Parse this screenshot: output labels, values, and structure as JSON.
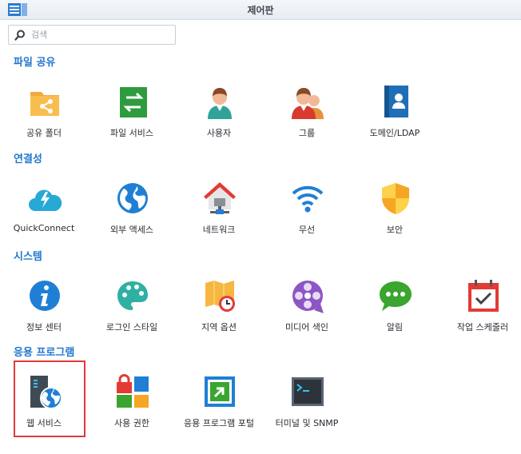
{
  "window": {
    "title": "제어판"
  },
  "search": {
    "placeholder": "검색"
  },
  "sections": [
    {
      "title": "파일 공유",
      "items": [
        "공유 폴더",
        "파일 서비스",
        "사용자",
        "그룹",
        "도메인/LDAP"
      ]
    },
    {
      "title": "연결성",
      "items": [
        "QuickConnect",
        "외부 액세스",
        "네트워크",
        "무선",
        "보안"
      ]
    },
    {
      "title": "시스템",
      "items": [
        "정보 센터",
        "로그인 스타일",
        "지역 옵션",
        "미디어 색인",
        "알림",
        "작업 스케줄러"
      ]
    },
    {
      "title": "응용 프로그램",
      "items": [
        "웹 서비스",
        "사용 권한",
        "응용 프로그램 포털",
        "터미널 및 SNMP"
      ]
    }
  ],
  "icons": [
    "shared-folder-icon",
    "file-services-icon",
    "user-icon",
    "group-icon",
    "domain-ldap-icon",
    "quickconnect-icon",
    "external-access-icon",
    "network-icon",
    "wireless-icon",
    "security-icon",
    "info-center-icon",
    "login-style-icon",
    "regional-options-icon",
    "media-index-icon",
    "notification-icon",
    "task-scheduler-icon",
    "web-services-icon",
    "privileges-icon",
    "application-portal-icon",
    "terminal-snmp-icon"
  ],
  "colors": {
    "section_title": "#1f77d0",
    "highlight": "#e03a3a"
  }
}
